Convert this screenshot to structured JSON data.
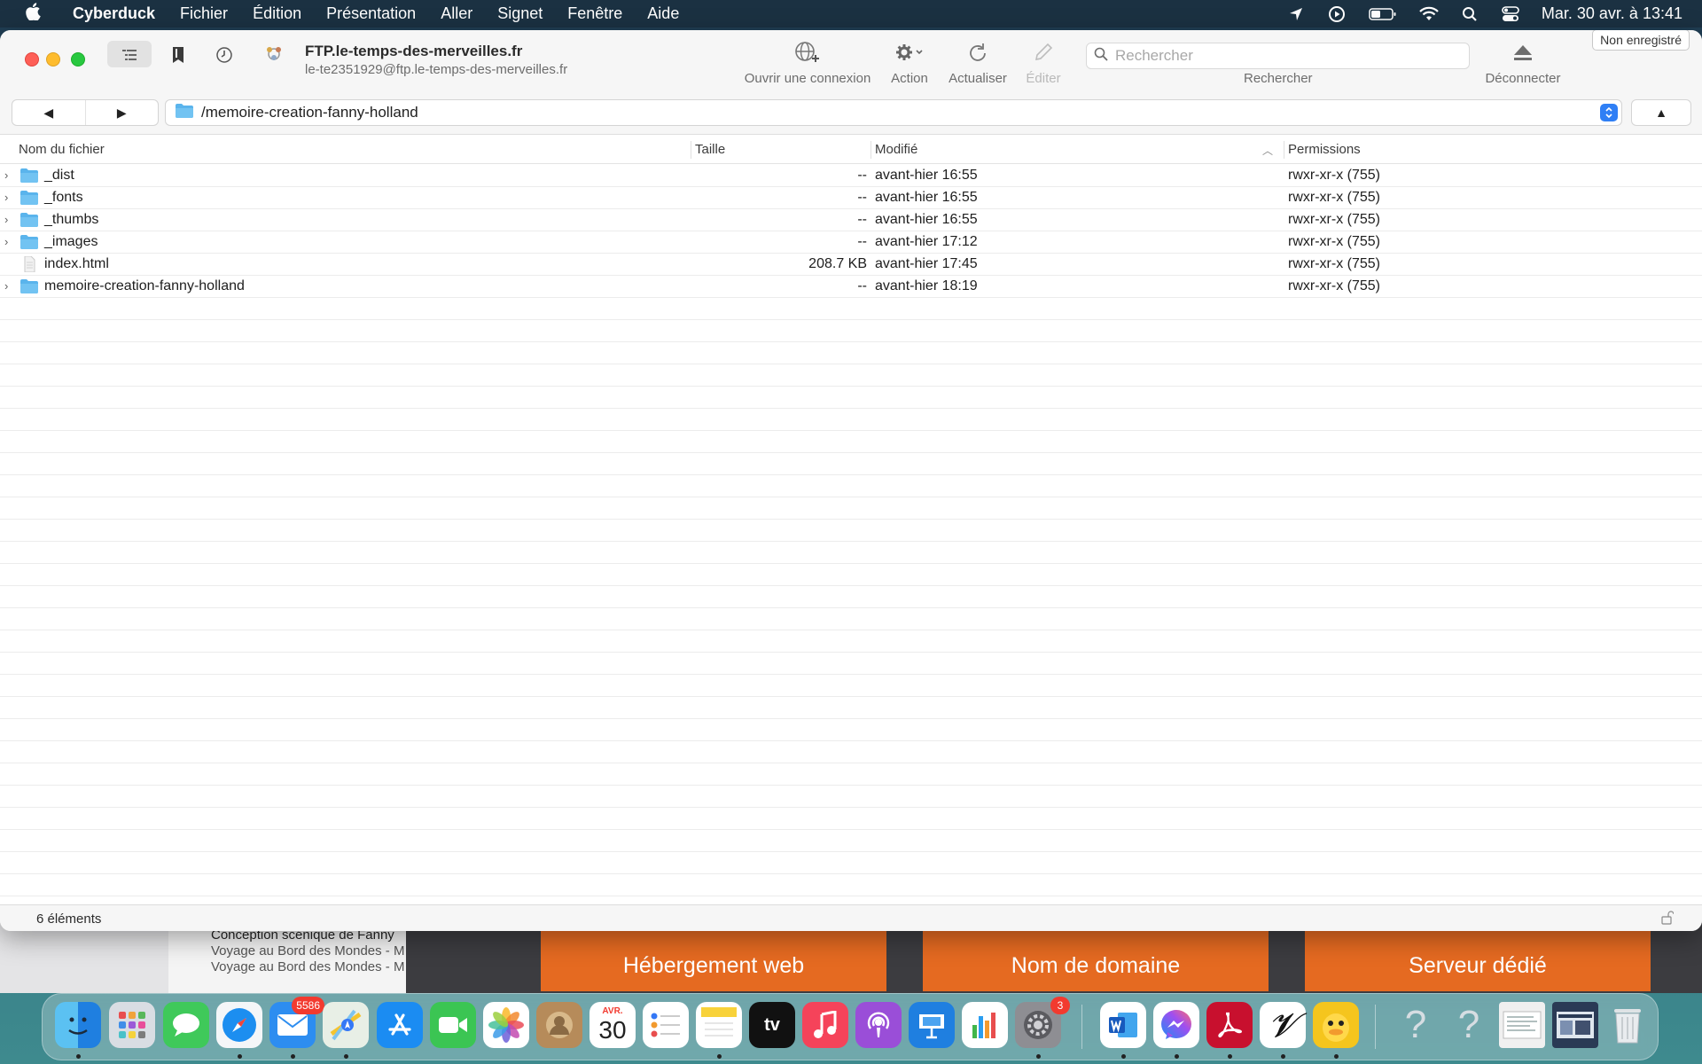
{
  "menubar": {
    "app_name": "Cyberduck",
    "items": [
      "Fichier",
      "Édition",
      "Présentation",
      "Aller",
      "Signet",
      "Fenêtre",
      "Aide"
    ],
    "clock": "Mar. 30 avr. à  13:41"
  },
  "window": {
    "unregistered_badge": "Non enregistré",
    "server_title": "FTP.le-temps-des-merveilles.fr",
    "server_subtitle": "le-te2351929@ftp.le-temps-des-merveilles.fr",
    "toolbar": {
      "open_connection": "Ouvrir une connexion",
      "action": "Action",
      "refresh": "Actualiser",
      "edit": "Éditer",
      "search_placeholder": "Rechercher",
      "search_label": "Rechercher",
      "disconnect": "Déconnecter"
    },
    "path": "/memoire-creation-fanny-holland",
    "columns": {
      "name": "Nom du fichier",
      "size": "Taille",
      "modified": "Modifié",
      "permissions": "Permissions"
    },
    "files": [
      {
        "name": "_dist",
        "type": "folder",
        "size": "--",
        "modified": "avant-hier 16:55",
        "permissions": "rwxr-xr-x (755)"
      },
      {
        "name": "_fonts",
        "type": "folder",
        "size": "--",
        "modified": "avant-hier 16:55",
        "permissions": "rwxr-xr-x (755)"
      },
      {
        "name": "_thumbs",
        "type": "folder",
        "size": "--",
        "modified": "avant-hier 16:55",
        "permissions": "rwxr-xr-x (755)"
      },
      {
        "name": "_images",
        "type": "folder",
        "size": "--",
        "modified": "avant-hier 17:12",
        "permissions": "rwxr-xr-x (755)"
      },
      {
        "name": "index.html",
        "type": "file",
        "size": "208.7 KB",
        "modified": "avant-hier 17:45",
        "permissions": "rwxr-xr-x (755)"
      },
      {
        "name": "memoire-creation-fanny-holland",
        "type": "folder",
        "size": "--",
        "modified": "avant-hier 18:19",
        "permissions": "rwxr-xr-x (755)"
      }
    ],
    "status": "6 éléments"
  },
  "background_page": {
    "list": [
      "Conception scénique de Fanny",
      "Voyage au Bord des Mondes - M",
      "Voyage au Bord des Mondes - M"
    ],
    "tiles": [
      "Hébergement web",
      "Nom de domaine",
      "Serveur dédié"
    ]
  },
  "dock": {
    "mail_badge": "5586",
    "calendar_month": "AVR.",
    "calendar_day": "30",
    "settings_badge": "3"
  },
  "colors": {
    "accent": "#2f7ff5",
    "folder": "#5ab4ec",
    "tile_orange": "#e56a21"
  }
}
